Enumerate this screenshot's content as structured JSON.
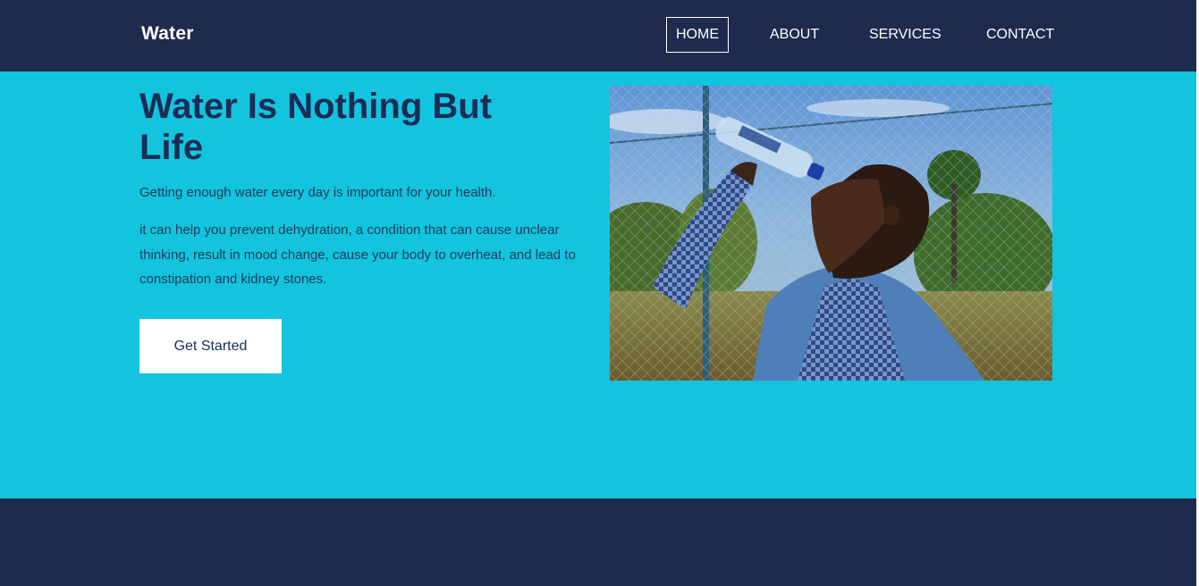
{
  "nav": {
    "brand": "Water",
    "links": [
      {
        "label": "HOME",
        "active": true
      },
      {
        "label": "ABOUT",
        "active": false
      },
      {
        "label": "SERVICES",
        "active": false
      },
      {
        "label": "CONTACT",
        "active": false
      }
    ]
  },
  "hero": {
    "title": "Water Is Nothing But Life",
    "paragraphs": [
      "Getting enough water every day is important for your health.",
      "it can help you prevent dehydration, a condition that can cause unclear thinking, result in mood change, cause your body to overheat, and lead to constipation and kidney stones."
    ],
    "cta_label": "Get Started",
    "image_alt": "Man drinking water from a bottle"
  },
  "colors": {
    "nav_bg": "#1f2a4f",
    "hero_bg": "#12c4de",
    "heading": "#1b2c55",
    "footer_bg": "#1f2a4f"
  }
}
